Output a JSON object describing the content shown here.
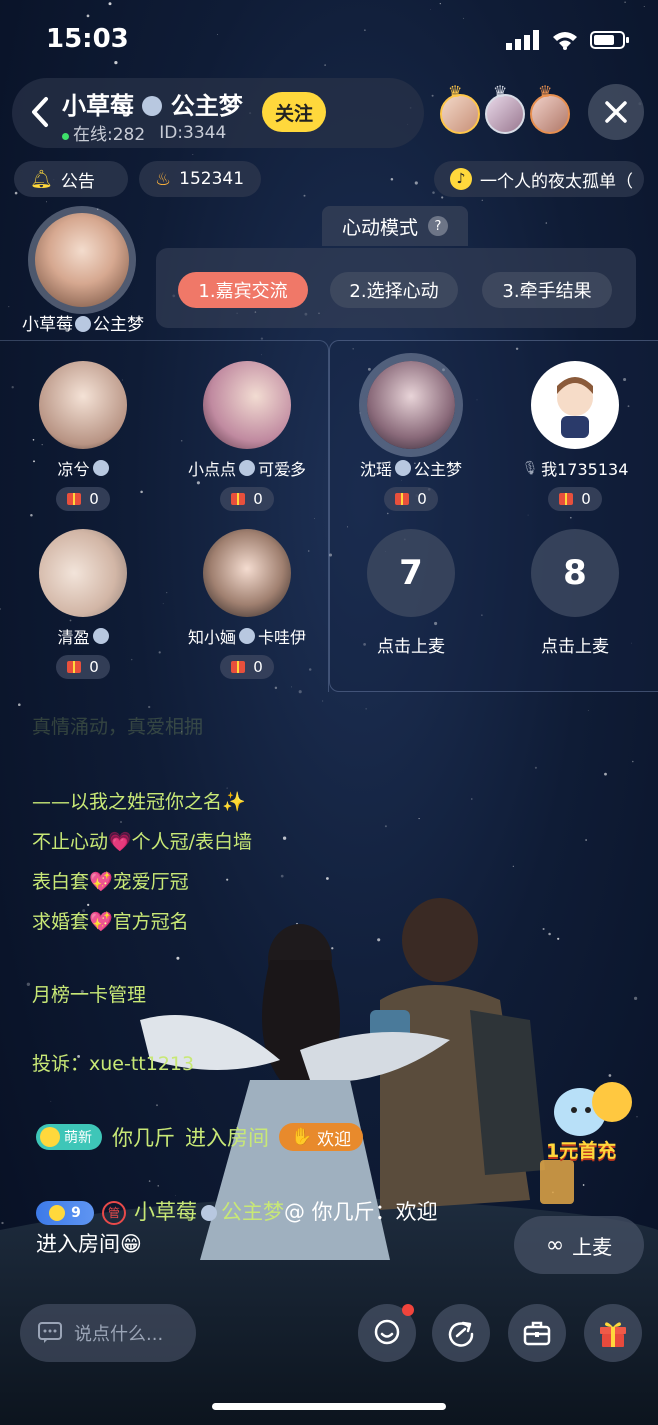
{
  "status_bar": {
    "time": "15:03"
  },
  "header": {
    "title": "小草莓",
    "title_suffix": "公主梦",
    "online": "在线:282",
    "room_id": "ID:3344",
    "follow_label": "关注"
  },
  "chips": {
    "announcement": "公告",
    "heat": "152341",
    "music": "一个人的夜太孤单（"
  },
  "mode": {
    "label": "心动模式",
    "help": "?",
    "steps": [
      "1.嘉宾交流",
      "2.选择心动",
      "3.牵手结果"
    ],
    "active_step": 1
  },
  "host": {
    "name": "小草莓",
    "suffix": "公主梦"
  },
  "seats": [
    {
      "name": "凉兮",
      "suffix": "",
      "gifts": "0"
    },
    {
      "name": "小点点",
      "suffix": "可爱多",
      "gifts": "0"
    },
    {
      "name": "沈瑶",
      "suffix": "公主梦",
      "gifts": "0"
    },
    {
      "name": "我1735134",
      "suffix": "",
      "gifts": "0"
    },
    {
      "name": "清盈",
      "suffix": "",
      "gifts": "0"
    },
    {
      "name": "知小婳",
      "suffix": "卡哇伊",
      "gifts": "0"
    },
    {
      "number": "7",
      "label": "点击上麦"
    },
    {
      "number": "8",
      "label": "点击上麦"
    }
  ],
  "notice": {
    "faded_line": "真情涌动，真爱相拥",
    "lines": [
      "——以我之姓冠你之名✨",
      "不止心动💗个人冠/表白墙",
      "表白套💖宠爱厅冠",
      "求婚套💖官方冠名",
      "月榜一卡管理",
      "投诉：xue-tt1213"
    ]
  },
  "chat": {
    "msg1_tag": "萌新",
    "msg1_user": "你几斤",
    "msg1_text": "进入房间",
    "msg1_welcome": "欢迎",
    "msg2_level": "9",
    "msg2_admin": "管",
    "msg2_user": "小草莓",
    "msg2_suffix": "公主梦",
    "msg2_text": "@ 你几斤：欢迎",
    "msg2_text2": "进入房间😁"
  },
  "promo": {
    "label": "1元首充"
  },
  "actions": {
    "mic_up": "上麦",
    "input_placeholder": "说点什么..."
  },
  "colors": {
    "accent": "#ffd83c",
    "notice": "#c8e876",
    "step_active": "#f07868"
  }
}
